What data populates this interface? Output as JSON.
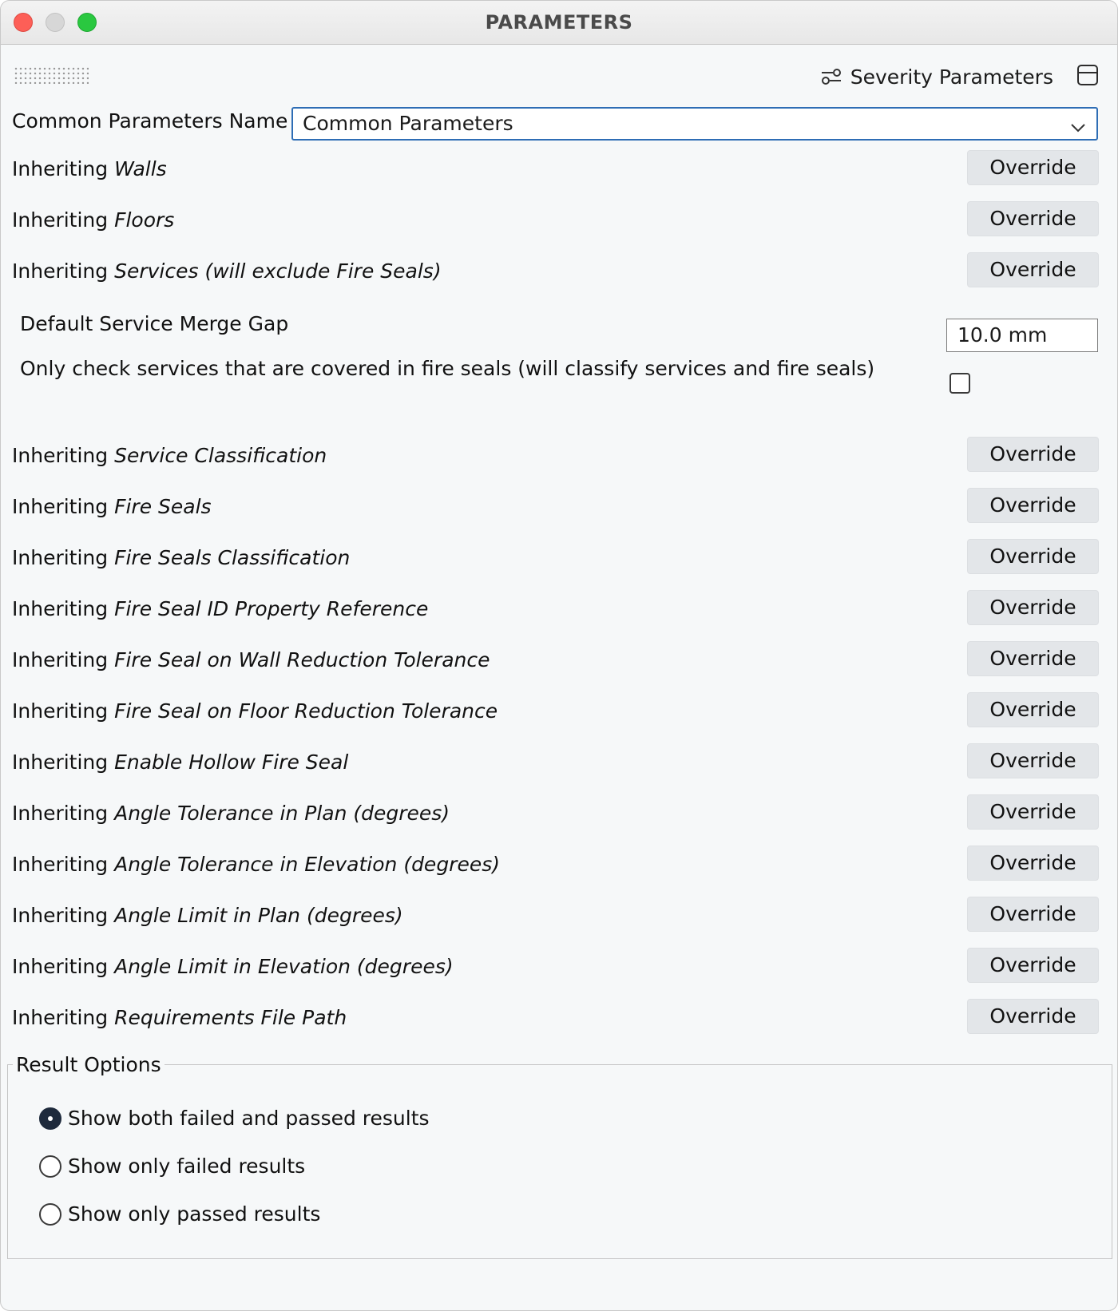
{
  "window": {
    "title": "PARAMETERS"
  },
  "toolbar": {
    "severity_label": "Severity Parameters",
    "severity_icon": "sliders-icon",
    "panel_icon": "panel-toggle-icon"
  },
  "common": {
    "label": "Common Parameters Name",
    "selected": "Common Parameters"
  },
  "inheriting_prefix": "Inheriting",
  "override_label": "Override",
  "top_rows": [
    {
      "name": "Walls"
    },
    {
      "name": "Floors"
    },
    {
      "name": "Services (will exclude Fire Seals)"
    }
  ],
  "service_options": {
    "merge_gap_label": "Default Service Merge Gap",
    "merge_gap_value": "10.0 mm",
    "only_check_label": "Only check services that are covered in fire seals (will classify services and fire seals)",
    "only_check_checked": false
  },
  "bottom_rows": [
    {
      "name": "Service Classification"
    },
    {
      "name": "Fire Seals"
    },
    {
      "name": "Fire Seals Classification"
    },
    {
      "name": "Fire Seal ID Property Reference"
    },
    {
      "name": "Fire Seal on Wall Reduction Tolerance"
    },
    {
      "name": "Fire Seal on Floor Reduction Tolerance"
    },
    {
      "name": "Enable Hollow Fire Seal"
    },
    {
      "name": "Angle Tolerance in Plan (degrees)"
    },
    {
      "name": "Angle Tolerance in Elevation (degrees)"
    },
    {
      "name": "Angle Limit in Plan (degrees)"
    },
    {
      "name": "Angle Limit in Elevation (degrees)"
    },
    {
      "name": "Requirements File Path"
    }
  ],
  "results": {
    "legend": "Result Options",
    "options": [
      {
        "label": "Show both failed and passed results",
        "selected": true
      },
      {
        "label": "Show only failed results",
        "selected": false
      },
      {
        "label": "Show only passed results",
        "selected": false
      }
    ]
  }
}
